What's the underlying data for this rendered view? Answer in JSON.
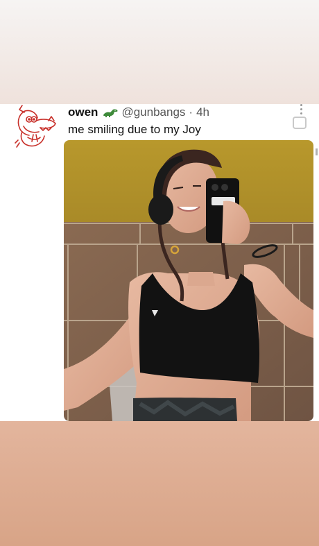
{
  "tweet": {
    "display_name": "owen",
    "handle": "@gunbangs",
    "separator": "·",
    "time_ago": "4h",
    "text": "me smiling due to my Joy"
  },
  "icons": {
    "avatar": "red-dragon-doodle-avatar",
    "name_badge": "green-dinosaur-emoji",
    "more": "vertical-ellipsis-icon",
    "share": "share-box-icon"
  },
  "colors": {
    "text_primary": "#111111",
    "text_secondary": "#555555",
    "background_top": "#f6f4f3",
    "background_bottom": "#dca98c",
    "card": "#ffffff"
  }
}
